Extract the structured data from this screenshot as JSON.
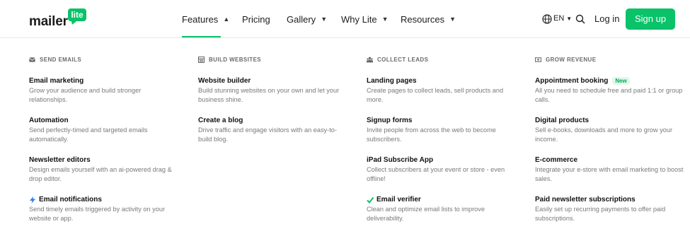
{
  "brand": {
    "word": "mailer",
    "badge": "lite",
    "green": "#09c269"
  },
  "nav": {
    "features": "Features",
    "pricing": "Pricing",
    "gallery": "Gallery",
    "why_lite": "Why Lite",
    "resources": "Resources",
    "lang": "EN",
    "login": "Log in",
    "signup": "Sign up"
  },
  "columns": [
    {
      "heading": "SEND EMAILS",
      "icon": "envelope-icon",
      "items": [
        {
          "title": "Email marketing",
          "desc": "Grow your audience and build stronger relationships."
        },
        {
          "title": "Automation",
          "desc": "Send perfectly-timed and targeted emails automatically."
        },
        {
          "title": "Newsletter editors",
          "desc": "Design emails yourself with an ai-powered drag & drop editor."
        },
        {
          "title": "Email notifications",
          "desc": "Send timely emails triggered by activity on your website or app."
        }
      ]
    },
    {
      "heading": "BUILD WEBSITES",
      "icon": "layout-icon",
      "items": [
        {
          "title": "Website builder",
          "desc": "Build stunning websites on your own and let your business shine."
        },
        {
          "title": "Create a blog",
          "desc": "Drive traffic and engage visitors with an easy-to-build blog."
        }
      ]
    },
    {
      "heading": "COLLECT LEADS",
      "icon": "users-icon",
      "items": [
        {
          "title": "Landing pages",
          "desc": "Create pages to collect leads, sell products and more."
        },
        {
          "title": "Signup forms",
          "desc": "Invite people from across the web to become subscribers."
        },
        {
          "title": "iPad Subscribe App",
          "desc": "Collect subscribers at your event or store - even offline!"
        },
        {
          "title": "Email verifier",
          "desc": "Clean and optimize email lists to improve deliverability."
        }
      ]
    },
    {
      "heading": "GROW REVENUE",
      "icon": "money-icon",
      "items": [
        {
          "title": "Appointment booking",
          "badge": "New",
          "desc": "All you need to schedule free and paid 1:1 or group calls."
        },
        {
          "title": "Digital products",
          "desc": "Sell e-books, downloads and more to grow your income."
        },
        {
          "title": "E-commerce",
          "desc": "Integrate your e-store with email marketing to boost sales."
        },
        {
          "title": "Paid newsletter subscriptions",
          "desc": "Easily set up recurring payments to offer paid subscriptions."
        }
      ]
    }
  ]
}
